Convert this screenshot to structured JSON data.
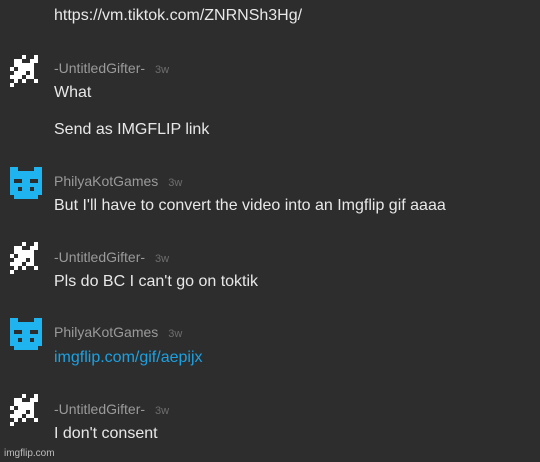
{
  "messages": [
    {
      "text": "https://vm.tiktok.com/ZNRNSh3Hg/"
    },
    {
      "author": "-UntitledGifter-",
      "time": "3w",
      "avatar": "white-pixel-avatar-icon",
      "lines": [
        "What",
        "Send as IMGFLIP link"
      ]
    },
    {
      "author": "PhilyaKotGames",
      "time": "3w",
      "avatar": "blue-cat-avatar-icon",
      "lines": [
        "But I'll have to convert the video into an Imgflip gif aaaa"
      ]
    },
    {
      "author": "-UntitledGifter-",
      "time": "3w",
      "avatar": "white-pixel-avatar-icon",
      "lines": [
        "Pls do BC I can't go on toktik"
      ]
    },
    {
      "author": "PhilyaKotGames",
      "time": "3w",
      "avatar": "blue-cat-avatar-icon",
      "lines": [
        "imgflip.com/gif/aepijx"
      ]
    },
    {
      "author": "-UntitledGifter-",
      "time": "3w",
      "avatar": "white-pixel-avatar-icon",
      "lines": [
        "I don't consent"
      ]
    }
  ],
  "watermark": "imgflip.com",
  "colors": {
    "background": "#2d2d2d",
    "link": "#1ba1e2",
    "author": "#9a9a9a",
    "timestamp": "#6e6e6e",
    "cat_avatar": "#1fb3f0"
  }
}
